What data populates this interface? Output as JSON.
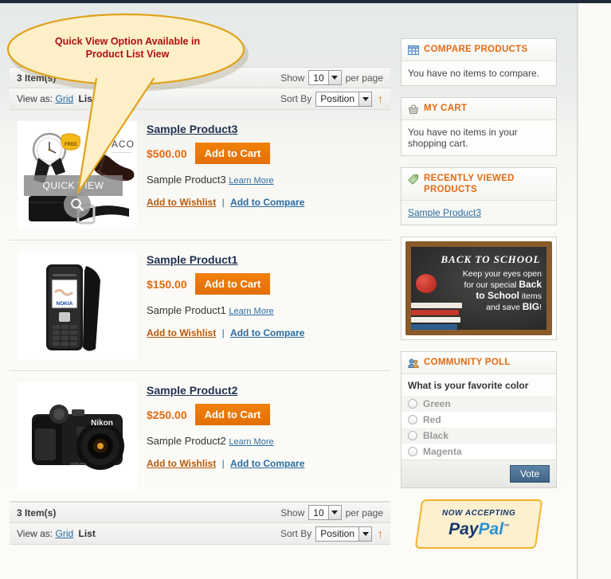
{
  "page": {
    "annotation": {
      "line1": "Quick View Option Available in",
      "line2": "Product List View",
      "color": "#b30e0e",
      "balloon_fill": "#fdf0c8",
      "balloon_stroke": "#e0a21c"
    }
  },
  "toolbar_top": {
    "amount": "3 Item(s)",
    "show_label": "Show",
    "show_value": "10",
    "per_page_label": "per page",
    "view_as_label": "View as:",
    "view_grid": "Grid",
    "view_list": "List",
    "sort_label": "Sort By",
    "sort_value": "Position",
    "sort_direction_icon": "arrow-up-icon"
  },
  "toolbar_bottom": {
    "amount": "3 Item(s)",
    "show_label": "Show",
    "show_value": "10",
    "per_page_label": "per page",
    "view_as_label": "View as:",
    "view_grid": "Grid",
    "view_list": "List",
    "sort_label": "Sort By",
    "sort_value": "Position",
    "sort_direction_icon": "arrow-up-icon"
  },
  "products": [
    {
      "name": "Sample Product3",
      "price": "$500.00",
      "add_to_cart": "Add to Cart",
      "description": "Sample Product3",
      "learn_more": "Learn More",
      "wishlist": "Add to Wishlist",
      "separator": "|",
      "compare": "Add to Compare",
      "image": "accessories-watch-shoes-wallet-belt",
      "quick_view_label": "QUICK VIEW",
      "badge": "FREE",
      "watermark": "ACO"
    },
    {
      "name": "Sample Product1",
      "price": "$150.00",
      "add_to_cart": "Add to Cart",
      "description": "Sample Product1",
      "learn_more": "Learn More",
      "wishlist": "Add to Wishlist",
      "separator": "|",
      "compare": "Add to Compare",
      "image": "nokia-mobile-phone",
      "image_brand": "NOKIA"
    },
    {
      "name": "Sample Product2",
      "price": "$250.00",
      "add_to_cart": "Add to Cart",
      "description": "Sample Product2",
      "learn_more": "Learn More",
      "wishlist": "Add to Wishlist",
      "separator": "|",
      "compare": "Add to Compare",
      "image": "nikon-digital-camera",
      "image_brand": "Nikon"
    }
  ],
  "sidebar": {
    "compare": {
      "title": "COMPARE PRODUCTS",
      "icon": "table-grid-icon",
      "body": "You have no items to compare."
    },
    "cart": {
      "title": "MY CART",
      "icon": "shopping-basket-icon",
      "body": "You have no items in your shopping cart."
    },
    "recently_viewed": {
      "title": "RECENTLY VIEWED PRODUCTS",
      "icon": "tag-icon",
      "items": [
        "Sample Product3"
      ]
    },
    "banner": {
      "heading": "BACK TO SCHOOL",
      "line1": "Keep your eyes open",
      "line2_a": "for our special ",
      "line2_b": "Back",
      "line3_a": "to School",
      "line3_b": " items",
      "line4_a": "and save ",
      "line4_b": "BIG",
      "line4_c": "!"
    },
    "poll": {
      "title": "COMMUNITY POLL",
      "icon": "people-icon",
      "question": "What is your favorite color",
      "options": [
        "Green",
        "Red",
        "Black",
        "Magenta"
      ],
      "vote_button": "Vote"
    },
    "paypal": {
      "now_accepting": "NOW ACCEPTING",
      "pay": "Pay",
      "pal": "Pal",
      "tm": "™"
    }
  }
}
